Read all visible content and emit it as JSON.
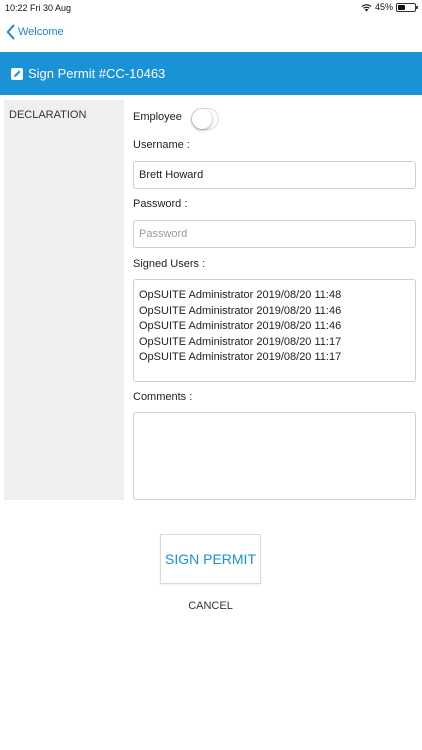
{
  "status_bar": {
    "time_date": "10:22  Fri 30 Aug",
    "battery": "45%",
    "battery_level": 0.45
  },
  "nav": {
    "back_label": "Welcome"
  },
  "header": {
    "title": "Sign Permit #CC-10463",
    "accent_color": "#1a92d6"
  },
  "sidebar": {
    "section": "DECLARATION"
  },
  "form": {
    "employee_label": "Employee",
    "employee_toggle_on": false,
    "username_label": "Username :",
    "username_value": "Brett Howard",
    "password_label": "Password :",
    "password_placeholder": "Password",
    "signed_users_label": "Signed Users :",
    "signed_users": [
      "OpSUITE Administrator 2019/08/20 11:48",
      "OpSUITE Administrator 2019/08/20 11:46",
      "OpSUITE Administrator 2019/08/20 11:46",
      "OpSUITE Administrator 2019/08/20 11:17",
      "OpSUITE Administrator 2019/08/20 11:17"
    ],
    "comments_label": "Comments :",
    "comments_value": ""
  },
  "actions": {
    "sign_label": "SIGN PERMIT",
    "cancel_label": "CANCEL"
  }
}
